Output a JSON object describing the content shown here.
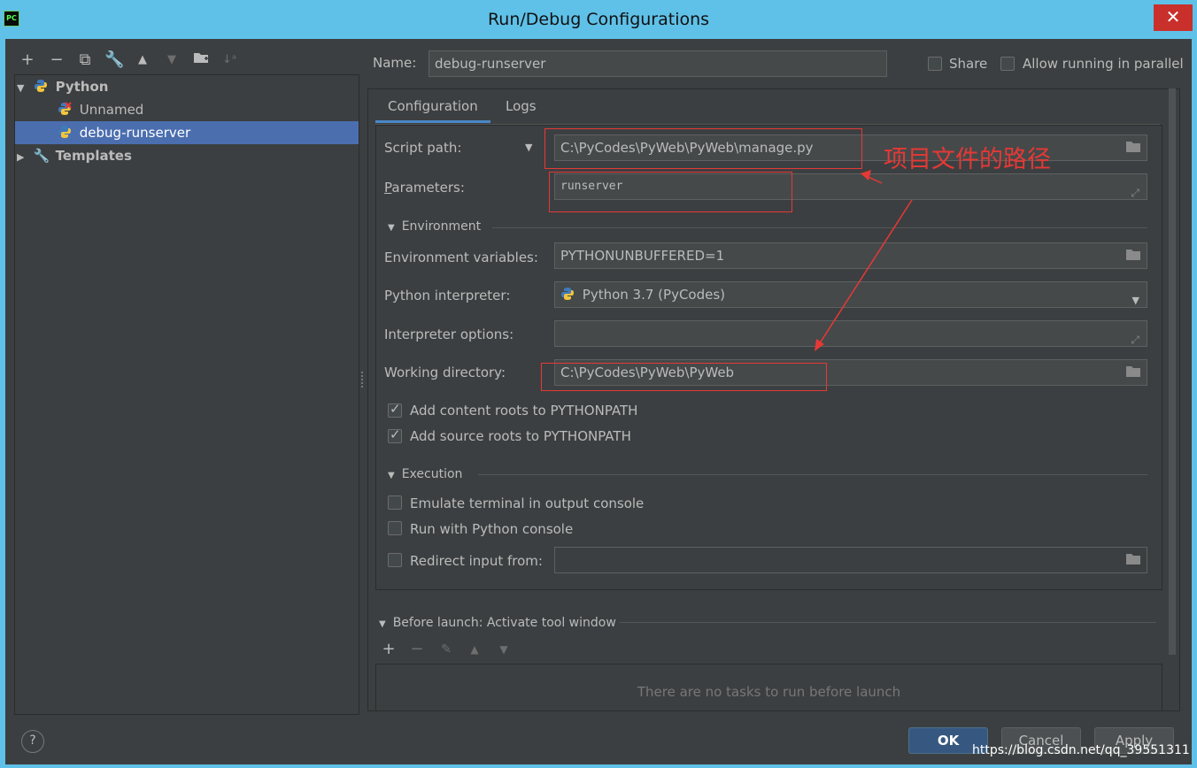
{
  "window": {
    "title": "Run/Debug Configurations",
    "app_badge": "PC"
  },
  "toolbar": {
    "icons": [
      "add-icon",
      "remove-icon",
      "copy-icon",
      "wrench-icon",
      "move-up-icon",
      "move-down-icon",
      "folder-add-icon",
      "sort-icon"
    ]
  },
  "tree": {
    "python": "Python",
    "unnamed": "Unnamed",
    "debug_runserver": "debug-runserver",
    "templates": "Templates"
  },
  "name_row": {
    "label": "Name:",
    "value": "debug-runserver",
    "share": "Share",
    "allow_parallel": "Allow running in parallel"
  },
  "tabs": {
    "configuration": "Configuration",
    "logs": "Logs"
  },
  "form": {
    "script_path_label": "Script path:",
    "script_path": "C:\\PyCodes\\PyWeb\\PyWeb\\manage.py",
    "parameters_label": "Parameters:",
    "parameters": "runserver",
    "environment": "Environment",
    "env_vars_label": "Environment variables:",
    "env_vars": "PYTHONUNBUFFERED=1",
    "interpreter_label": "Python interpreter:",
    "interpreter": "Python 3.7 (PyCodes)",
    "interp_options_label": "Interpreter options:",
    "interp_options": "",
    "workdir_label": "Working directory:",
    "workdir": "C:\\PyCodes\\PyWeb\\PyWeb",
    "add_content_roots": "Add content roots to PYTHONPATH",
    "add_source_roots": "Add source roots to PYTHONPATH",
    "execution": "Execution",
    "emulate_terminal": "Emulate terminal in output console",
    "run_python_console": "Run with Python console",
    "redirect_input": "Redirect input from:",
    "redirect_value": ""
  },
  "before_launch": {
    "title": "Before launch: Activate tool window",
    "empty": "There are no tasks to run before launch"
  },
  "buttons": {
    "ok": "OK",
    "cancel": "Cancel",
    "apply": "Apply",
    "help": "?"
  },
  "annotation": {
    "text": "项目文件的路径",
    "color": "#e53935"
  },
  "watermark": "https://blog.csdn.net/qq_39551311"
}
